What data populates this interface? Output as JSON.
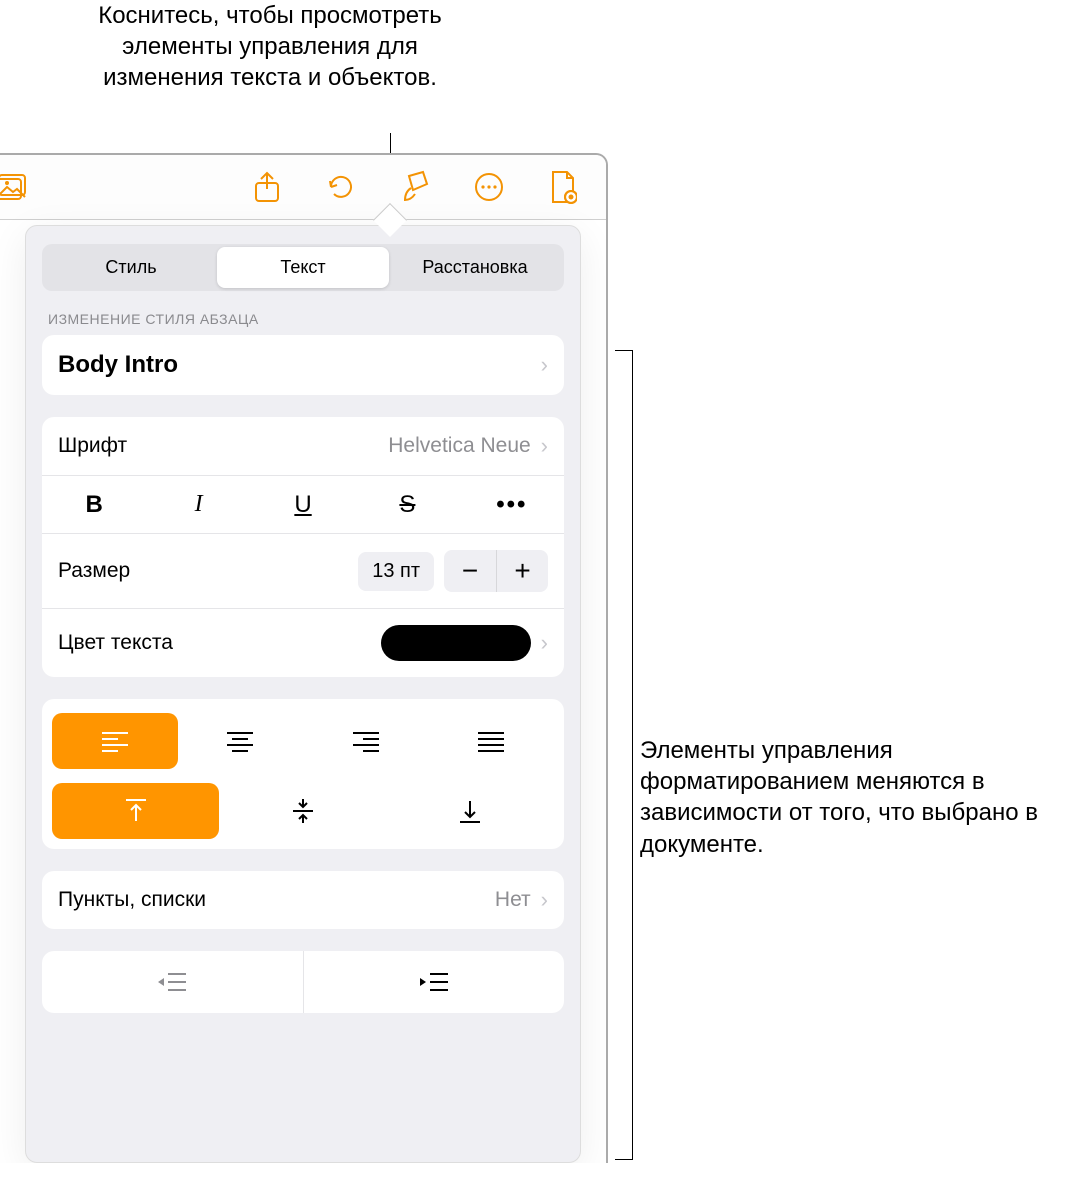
{
  "callouts": {
    "top": "Коснитесь, чтобы просмотреть элементы управления для изменения текста и объектов.",
    "right": "Элементы управления форматированием меняются в зависимости от того, что выбрано в документе."
  },
  "toolbar": {
    "icons": {
      "share": "share-icon",
      "undo": "undo-icon",
      "format": "format-brush-icon",
      "more": "more-circle-icon",
      "document": "document-icon",
      "media": "media-icon"
    }
  },
  "tabs": {
    "items": [
      "Стиль",
      "Текст",
      "Расстановка"
    ],
    "active_index": 1
  },
  "section_header": "ИЗМЕНЕНИЕ СТИЛЯ АБЗАЦА",
  "paragraph_style": "Body Intro",
  "font": {
    "label": "Шрифт",
    "value": "Helvetica Neue"
  },
  "style_buttons": {
    "bold": "B",
    "italic": "I",
    "underline": "U",
    "strike": "S",
    "more": "•••"
  },
  "size": {
    "label": "Размер",
    "value": "13 пт",
    "minus": "−",
    "plus": "+"
  },
  "text_color": {
    "label": "Цвет текста",
    "value_hex": "#000000"
  },
  "bullets": {
    "label": "Пункты, списки",
    "value": "Нет"
  }
}
